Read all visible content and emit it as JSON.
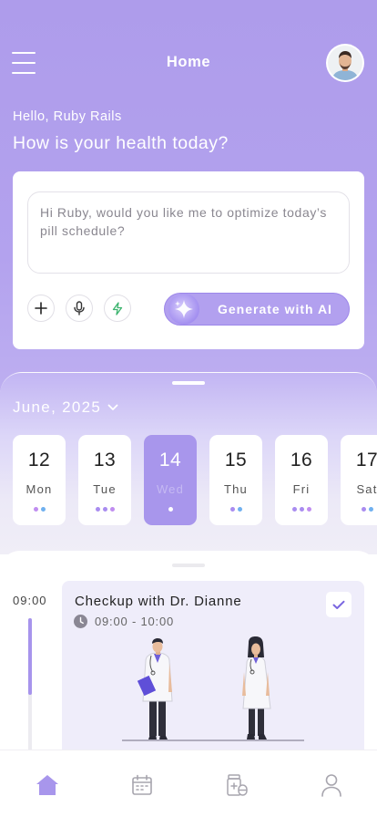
{
  "header": {
    "title": "Home",
    "menu_icon": "hamburger-menu-icon",
    "avatar_icon": "user-avatar"
  },
  "greeting": {
    "hello": "Hello, Ruby Rails",
    "question": "How is your health today?"
  },
  "ai_card": {
    "prompt_text": "Hi Ruby, would you like me to optimize today’s pill schedule?",
    "tools": [
      "plus-icon",
      "microphone-icon",
      "lightning-icon"
    ],
    "generate_label": "Generate with AI",
    "accent": "#a896ec"
  },
  "calendar": {
    "month_label": "June, 2025",
    "days": [
      {
        "num": "12",
        "name": "Mon",
        "dots": [
          "#c08df0",
          "#6fb0ef"
        ],
        "active": false
      },
      {
        "num": "13",
        "name": "Tue",
        "dots": [
          "#a98cf0",
          "#a98cf0",
          "#c08df0"
        ],
        "active": false
      },
      {
        "num": "14",
        "name": "Wed",
        "dots": [
          "#ffffff"
        ],
        "active": true
      },
      {
        "num": "15",
        "name": "Thu",
        "dots": [
          "#a98cf0",
          "#6fb0ef"
        ],
        "active": false
      },
      {
        "num": "16",
        "name": "Fri",
        "dots": [
          "#a98cf0",
          "#a98cf0",
          "#c08df0"
        ],
        "active": false
      },
      {
        "num": "17",
        "name": "Sat",
        "dots": [
          "#a98cf0",
          "#6fb0ef"
        ],
        "active": false
      }
    ]
  },
  "schedule": {
    "time_label": "09:00",
    "appointment": {
      "title": "Checkup with Dr. Dianne",
      "time_range": "09:00 - 10:00",
      "completed": true,
      "illustration": "two-doctors-illustration"
    }
  },
  "bottom_nav": {
    "items": [
      {
        "icon": "home-icon",
        "active": true
      },
      {
        "icon": "calendar-icon",
        "active": false
      },
      {
        "icon": "medicine-icon",
        "active": false
      },
      {
        "icon": "profile-icon",
        "active": false
      }
    ]
  }
}
